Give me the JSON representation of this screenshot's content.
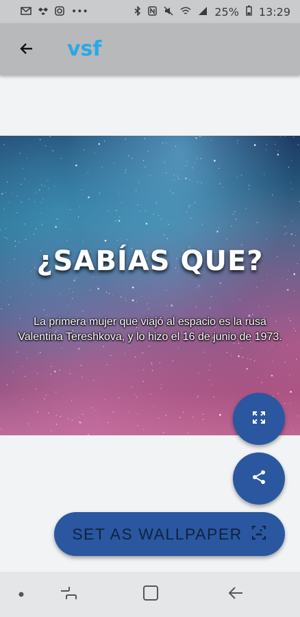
{
  "status_bar": {
    "left_icons": [
      "gmail-icon",
      "dropbox-icon",
      "instagram-icon",
      "more-icon"
    ],
    "right_icons": [
      "bluetooth-icon",
      "nfc-icon",
      "mute-icon",
      "wifi-icon",
      "signal-icon"
    ],
    "battery": "25%",
    "time": "13:29"
  },
  "app_bar": {
    "title": "vsf",
    "back_icon": "arrow-back-icon",
    "title_color": "#29a8e8"
  },
  "card": {
    "heading": "¿SABÍAS QUE?",
    "body": "La primera mujer que viajó al espacio es la rusa Valentina Tereshkova, y lo hizo el 16 de junio de 1973."
  },
  "actions": {
    "fullscreen_icon": "fullscreen-icon",
    "share_icon": "share-icon",
    "wallpaper_label": "SET AS WALLPAPER",
    "wallpaper_icon": "wallpaper-icon",
    "accent": "#2a57a0"
  },
  "nav_bar": {
    "items": [
      "dot-icon",
      "recent-apps-icon",
      "home-icon",
      "back-icon"
    ]
  }
}
